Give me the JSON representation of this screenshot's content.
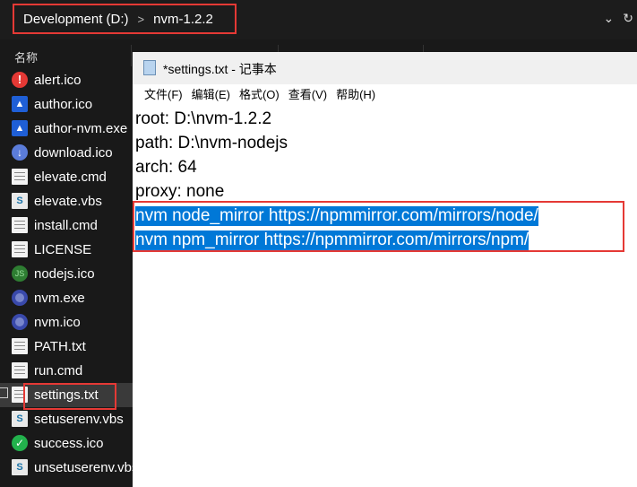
{
  "explorer": {
    "breadcrumb": [
      "Development (D:)",
      "nvm-1.2.2"
    ],
    "column_name": "名称",
    "files": [
      {
        "name": "alert.ico",
        "icon": "alert-icon"
      },
      {
        "name": "author.ico",
        "icon": "author-icon"
      },
      {
        "name": "author-nvm.exe",
        "icon": "author-nvm-icon"
      },
      {
        "name": "download.ico",
        "icon": "download-icon"
      },
      {
        "name": "elevate.cmd",
        "icon": "page-icon"
      },
      {
        "name": "elevate.vbs",
        "icon": "script-icon"
      },
      {
        "name": "install.cmd",
        "icon": "page-icon"
      },
      {
        "name": "LICENSE",
        "icon": "page-icon"
      },
      {
        "name": "nodejs.ico",
        "icon": "nodejs-icon"
      },
      {
        "name": "nvm.exe",
        "icon": "nvm-icon"
      },
      {
        "name": "nvm.ico",
        "icon": "nvm-icon"
      },
      {
        "name": "PATH.txt",
        "icon": "page-icon"
      },
      {
        "name": "run.cmd",
        "icon": "page-icon"
      },
      {
        "name": "settings.txt",
        "icon": "page-icon"
      },
      {
        "name": "setuserenv.vbs",
        "icon": "script-icon"
      },
      {
        "name": "success.ico",
        "icon": "success-icon"
      },
      {
        "name": "unsetuserenv.vbs",
        "icon": "script-icon"
      }
    ],
    "selected_file": "settings.txt"
  },
  "notepad": {
    "title": "*settings.txt - 记事本",
    "menu": [
      "文件(F)",
      "编辑(E)",
      "格式(O)",
      "查看(V)",
      "帮助(H)"
    ],
    "lines": [
      "root: D:\\nvm-1.2.2",
      "path: D:\\nvm-nodejs",
      "arch: 64",
      "proxy: none",
      "nvm node_mirror https://npmmirror.com/mirrors/node/",
      "nvm npm_mirror https://npmmirror.com/mirrors/npm/"
    ],
    "selected_lines": [
      4,
      5
    ]
  },
  "colors": {
    "selection": "#0078d7",
    "highlight_border": "#e53935"
  }
}
